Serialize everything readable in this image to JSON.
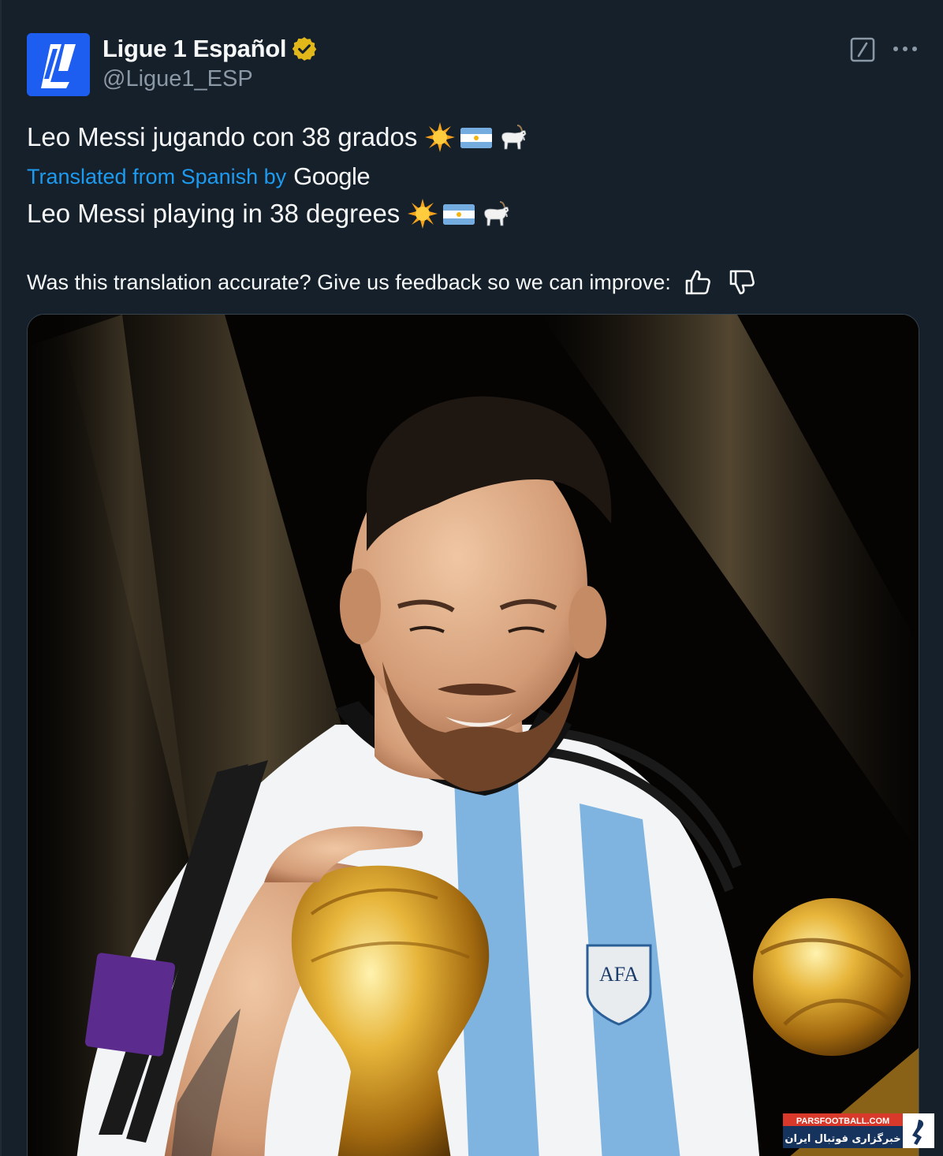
{
  "account": {
    "display_name": "Ligue 1 Español",
    "handle": "@Ligue1_ESP",
    "avatar_icon": "ligue1-logo-icon",
    "verified_icon": "verified-badge-icon",
    "verified_color": "#e2b719",
    "avatar_color": "#1d5ef0"
  },
  "header_actions": {
    "grok_icon": "grok-icon",
    "more_icon": "more-options-icon"
  },
  "tweet": {
    "text": "Leo Messi jugando con 38 grados",
    "emojis": [
      "sun-icon",
      "argentina-flag-icon",
      "goat-icon"
    ]
  },
  "translation": {
    "label": "Translated from Spanish by",
    "provider": "Google",
    "text": "Leo Messi playing in 38 degrees",
    "feedback_prompt": "Was this translation accurate? Give us feedback so we can improve:",
    "thumbs_up_icon": "thumbs-up-icon",
    "thumbs_down_icon": "thumbs-down-icon"
  },
  "media": {
    "image_name": "messi-world-cup-trophy-photo",
    "watermark_line1": "PARSFOOTBALL.COM",
    "watermark_line2": "خبرگزاری فوتبال ایران"
  },
  "colors": {
    "background": "#15202b",
    "text": "#f7f9f9",
    "secondary_text": "#8b98a5",
    "link": "#1d9bf0"
  }
}
